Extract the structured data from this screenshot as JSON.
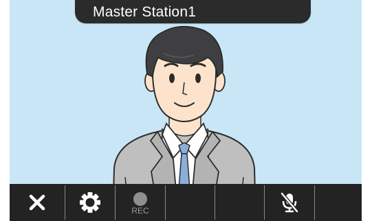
{
  "title_bar": {
    "station_name": "Master Station1"
  },
  "toolbar": {
    "end_call_icon": "close-icon",
    "settings_icon": "gear-icon",
    "record_icon": "record-icon",
    "record_label": "REC",
    "mute_icon": "mic-muted-icon"
  },
  "colors": {
    "screen_background": "#c9e6f6",
    "toolbar_background": "#232323",
    "title_background": "#2b2b2b",
    "icon_active": "#ffffff",
    "icon_disabled": "#8f8f8f"
  }
}
